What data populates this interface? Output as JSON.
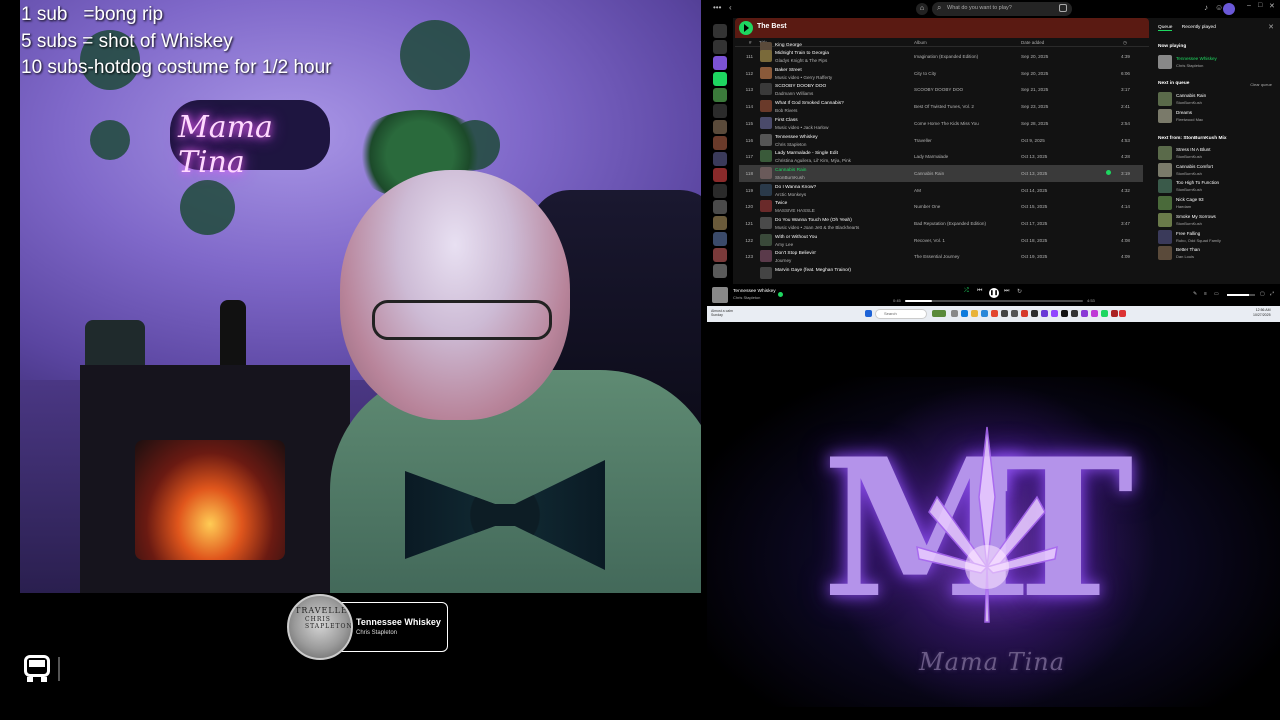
{
  "overlay": {
    "sub_goals": [
      "1 sub   =bong rip",
      "5 subs = shot of Whiskey",
      "10 subs-hotdog costume for 1/2 hour"
    ]
  },
  "webcam": {
    "neon_sign": "Mama Tina"
  },
  "now_playing_widget": {
    "title": "Tennessee Whiskey",
    "artist": "Chris Stapleton",
    "album_art_text": "TRAVELLER",
    "album_art_subtext": "CHRIS STAPLETON"
  },
  "stream_icons": {
    "bottom_left": "bus-icon"
  },
  "spotify": {
    "search_placeholder": "What do you want to play?",
    "playlist_title": "The Best",
    "columns": {
      "num": "#",
      "title": "Title",
      "album": "Album",
      "date": "Date added",
      "duration": "clock-icon"
    },
    "tracks": [
      {
        "num": "",
        "title": "King George",
        "artist": "",
        "album": "",
        "date": "",
        "duration": ""
      },
      {
        "num": "111",
        "title": "Midnight Train to Georgia",
        "artist": "Gladys Knight & The Pips",
        "album": "Imagination (Expanded Edition)",
        "date": "Sep 20, 2025",
        "duration": "4:39"
      },
      {
        "num": "112",
        "title": "Baker Street",
        "artist": "Music video • Gerry Rafferty",
        "album": "City to City",
        "date": "Sep 20, 2025",
        "duration": "6:06"
      },
      {
        "num": "113",
        "title": "SCOOBY DOOBY DOO",
        "artist": "Dadmann Williams",
        "album": "SCOOBY DOOBY DOO",
        "date": "Sep 21, 2025",
        "duration": "3:17"
      },
      {
        "num": "114",
        "title": "What If God Smoked Cannabis?",
        "artist": "Bob Rivers",
        "album": "Best Of Twisted Tunes, Vol. 2",
        "date": "Sep 23, 2025",
        "duration": "2:41"
      },
      {
        "num": "115",
        "title": "First Class",
        "artist": "Music video • Jack Harlow",
        "album": "Come Home The Kids Miss You",
        "date": "Sep 28, 2025",
        "duration": "2:54"
      },
      {
        "num": "116",
        "title": "Tennessee Whiskey",
        "artist": "Chris Stapleton",
        "album": "Traveller",
        "date": "Oct 9, 2025",
        "duration": "4:53"
      },
      {
        "num": "117",
        "title": "Lady Marmalade - Single Edit",
        "artist": "Christina Aguilera, Lil' Kim, Mýa, Pink",
        "album": "Lady Marmalade",
        "date": "Oct 13, 2025",
        "duration": "4:28"
      },
      {
        "num": "118",
        "title": "Cannabis Rain",
        "artist": "StonBurnKush",
        "album": "Cannabis Rain",
        "date": "Oct 13, 2025",
        "duration": "3:19",
        "selected": true
      },
      {
        "num": "119",
        "title": "Do I Wanna Know?",
        "artist": "Arctic Monkeys",
        "album": "AM",
        "date": "Oct 14, 2025",
        "duration": "4:32"
      },
      {
        "num": "120",
        "title": "Twice",
        "artist": "MASSIVE HASSLE",
        "album": "Number One",
        "date": "Oct 15, 2025",
        "duration": "4:14"
      },
      {
        "num": "121",
        "title": "Do You Wanna Touch Me (Oh Yeah)",
        "artist": "Music video • Joan Jett & the Blackhearts",
        "album": "Bad Reputation (Expanded Edition)",
        "date": "Oct 17, 2025",
        "duration": "3:47"
      },
      {
        "num": "122",
        "title": "With or Without You",
        "artist": "Amy Lee",
        "album": "Recover, Vol. 1",
        "date": "Oct 18, 2025",
        "duration": "4:08"
      },
      {
        "num": "123",
        "title": "Don't Stop Believin'",
        "artist": "Journey",
        "album": "The Essential Journey",
        "date": "Oct 19, 2025",
        "duration": "4:09"
      },
      {
        "num": "",
        "title": "Marvin Gaye (feat. Meghan Trainor)",
        "artist": "",
        "album": "",
        "date": "",
        "duration": ""
      }
    ],
    "queue": {
      "tabs": [
        "Queue",
        "Recently played"
      ],
      "now_playing_label": "Now playing",
      "now_playing": {
        "title": "Tennessee Whiskey",
        "artist": "Chris Stapleton"
      },
      "next_label": "Next in queue",
      "clear_label": "Clear queue",
      "next": [
        {
          "title": "Cannabis Rain",
          "artist": "StonBurnKush"
        },
        {
          "title": "Dreams",
          "artist": "Fleetwood Mac"
        }
      ],
      "from_label": "Next from: StonBurnKush Mix",
      "from_items": [
        {
          "title": "Stress IN A Blunt",
          "artist": "StonBurnKush"
        },
        {
          "title": "Cannabis Comfort",
          "artist": "StonBurnKush"
        },
        {
          "title": "Too High To Function",
          "artist": "StonBurnKush"
        },
        {
          "title": "Nick Cage 93",
          "artist": "Haedam"
        },
        {
          "title": "Smoke My Sorrows",
          "artist": "StonBurnKush"
        },
        {
          "title": "Free Falling",
          "artist": "Rubo, Odd Squad Family"
        },
        {
          "title": "Better Than",
          "artist": "Dan Louis"
        }
      ]
    },
    "player": {
      "title": "Tennessee Whiskey",
      "artist": "Chris Stapleton",
      "elapsed": "0:45",
      "total": "4:53",
      "progress": 0.15,
      "volume": 0.8
    },
    "taskbar": {
      "weather": "Almost a calm",
      "weather_sub": "Sunday",
      "search": "Search",
      "time": "12:56 AM",
      "date": "10/27/2025"
    }
  },
  "logo": {
    "monogram": "MT",
    "name": "Mama Tina"
  }
}
